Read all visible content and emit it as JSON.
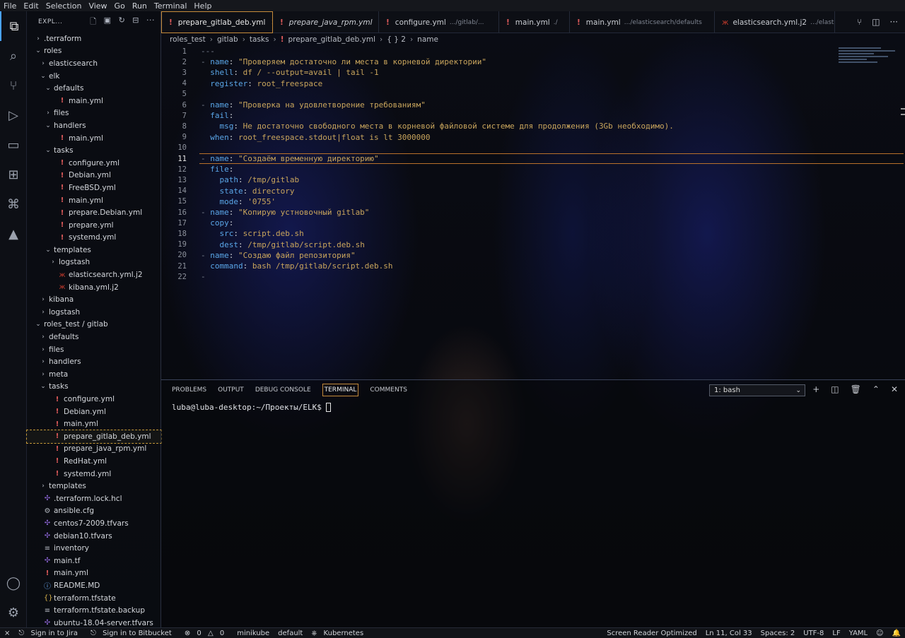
{
  "menu": [
    "File",
    "Edit",
    "Selection",
    "View",
    "Go",
    "Run",
    "Terminal",
    "Help"
  ],
  "explorer": {
    "title": "EXPL...",
    "tree": [
      {
        "label": ".terraform",
        "depth": 1,
        "type": "folder",
        "open": false
      },
      {
        "label": "roles",
        "depth": 1,
        "type": "folder",
        "open": true
      },
      {
        "label": "elasticsearch",
        "depth": 2,
        "type": "folder",
        "open": false
      },
      {
        "label": "elk",
        "depth": 2,
        "type": "folder",
        "open": true
      },
      {
        "label": "defaults",
        "depth": 3,
        "type": "folder",
        "open": true
      },
      {
        "label": "main.yml",
        "depth": 4,
        "type": "file",
        "icon": "yaml"
      },
      {
        "label": "files",
        "depth": 3,
        "type": "folder",
        "open": false
      },
      {
        "label": "handlers",
        "depth": 3,
        "type": "folder",
        "open": true
      },
      {
        "label": "main.yml",
        "depth": 4,
        "type": "file",
        "icon": "yaml"
      },
      {
        "label": "tasks",
        "depth": 3,
        "type": "folder",
        "open": true
      },
      {
        "label": "configure.yml",
        "depth": 4,
        "type": "file",
        "icon": "yaml"
      },
      {
        "label": "Debian.yml",
        "depth": 4,
        "type": "file",
        "icon": "yaml"
      },
      {
        "label": "FreeBSD.yml",
        "depth": 4,
        "type": "file",
        "icon": "yaml"
      },
      {
        "label": "main.yml",
        "depth": 4,
        "type": "file",
        "icon": "yaml"
      },
      {
        "label": "prepare.Debian.yml",
        "depth": 4,
        "type": "file",
        "icon": "yaml"
      },
      {
        "label": "prepare.yml",
        "depth": 4,
        "type": "file",
        "icon": "yaml"
      },
      {
        "label": "systemd.yml",
        "depth": 4,
        "type": "file",
        "icon": "yaml"
      },
      {
        "label": "templates",
        "depth": 3,
        "type": "folder",
        "open": true
      },
      {
        "label": "logstash",
        "depth": 4,
        "type": "folder",
        "open": false
      },
      {
        "label": "elasticsearch.yml.j2",
        "depth": 4,
        "type": "file",
        "icon": "j2"
      },
      {
        "label": "kibana.yml.j2",
        "depth": 4,
        "type": "file",
        "icon": "j2"
      },
      {
        "label": "kibana",
        "depth": 2,
        "type": "folder",
        "open": false
      },
      {
        "label": "logstash",
        "depth": 2,
        "type": "folder",
        "open": false
      },
      {
        "label": "roles_test / gitlab",
        "depth": 1,
        "type": "folder",
        "open": true
      },
      {
        "label": "defaults",
        "depth": 2,
        "type": "folder",
        "open": false
      },
      {
        "label": "files",
        "depth": 2,
        "type": "folder",
        "open": false
      },
      {
        "label": "handlers",
        "depth": 2,
        "type": "folder",
        "open": false
      },
      {
        "label": "meta",
        "depth": 2,
        "type": "folder",
        "open": false
      },
      {
        "label": "tasks",
        "depth": 2,
        "type": "folder",
        "open": true
      },
      {
        "label": "configure.yml",
        "depth": 3,
        "type": "file",
        "icon": "yaml"
      },
      {
        "label": "Debian.yml",
        "depth": 3,
        "type": "file",
        "icon": "yaml"
      },
      {
        "label": "main.yml",
        "depth": 3,
        "type": "file",
        "icon": "yaml"
      },
      {
        "label": "prepare_gitlab_deb.yml",
        "depth": 3,
        "type": "file",
        "icon": "yaml",
        "selected": true
      },
      {
        "label": "prepare_java_rpm.yml",
        "depth": 3,
        "type": "file",
        "icon": "yaml"
      },
      {
        "label": "RedHat.yml",
        "depth": 3,
        "type": "file",
        "icon": "yaml"
      },
      {
        "label": "systemd.yml",
        "depth": 3,
        "type": "file",
        "icon": "yaml"
      },
      {
        "label": "templates",
        "depth": 2,
        "type": "folder",
        "open": false
      },
      {
        "label": ".terraform.lock.hcl",
        "depth": 1,
        "type": "file",
        "icon": "tf"
      },
      {
        "label": "ansible.cfg",
        "depth": 1,
        "type": "file",
        "icon": "gear"
      },
      {
        "label": "centos7-2009.tfvars",
        "depth": 1,
        "type": "file",
        "icon": "tf"
      },
      {
        "label": "debian10.tfvars",
        "depth": 1,
        "type": "file",
        "icon": "tf"
      },
      {
        "label": "inventory",
        "depth": 1,
        "type": "file",
        "icon": "lines"
      },
      {
        "label": "main.tf",
        "depth": 1,
        "type": "file",
        "icon": "tf"
      },
      {
        "label": "main.yml",
        "depth": 1,
        "type": "file",
        "icon": "yaml"
      },
      {
        "label": "README.MD",
        "depth": 1,
        "type": "file",
        "icon": "info"
      },
      {
        "label": "terraform.tfstate",
        "depth": 1,
        "type": "file",
        "icon": "brace"
      },
      {
        "label": "terraform.tfstate.backup",
        "depth": 1,
        "type": "file",
        "icon": "lines"
      },
      {
        "label": "ubuntu-18.04-server.tfvars",
        "depth": 1,
        "type": "file",
        "icon": "tf"
      }
    ]
  },
  "tabs": [
    {
      "label": "prepare_gitlab_deb.yml",
      "desc": "",
      "icon": "yaml",
      "active": true,
      "italic": false
    },
    {
      "label": "prepare_java_rpm.yml",
      "desc": "",
      "icon": "yaml",
      "active": false,
      "italic": true
    },
    {
      "label": "configure.yml",
      "desc": ".../gitlab/...",
      "icon": "yaml",
      "active": false,
      "italic": false
    },
    {
      "label": "main.yml",
      "desc": "./",
      "icon": "yaml",
      "active": false,
      "italic": false
    },
    {
      "label": "main.yml",
      "desc": ".../elasticsearch/defaults",
      "icon": "yaml",
      "active": false,
      "italic": false
    },
    {
      "label": "elasticsearch.yml.j2",
      "desc": ".../elasticsear",
      "icon": "j2",
      "active": false,
      "italic": false
    }
  ],
  "breadcrumb": [
    "roles_test",
    "gitlab",
    "tasks",
    "prepare_gitlab_deb.yml",
    "{ } 2",
    "name"
  ],
  "editor": {
    "current_line": 11,
    "lines": [
      [
        [
          "dash",
          "---"
        ]
      ],
      [
        [
          "dash",
          "- "
        ],
        [
          "k",
          "name"
        ],
        [
          "p",
          ": "
        ],
        [
          "s",
          "\"Проверяем достаточно ли места в корневой директории\""
        ]
      ],
      [
        [
          "p",
          "  "
        ],
        [
          "k",
          "shell"
        ],
        [
          "p",
          ": "
        ],
        [
          "s",
          "df / --output=avail | tail -1"
        ]
      ],
      [
        [
          "p",
          "  "
        ],
        [
          "k",
          "register"
        ],
        [
          "p",
          ": "
        ],
        [
          "s",
          "root_freespace"
        ]
      ],
      [],
      [
        [
          "dash",
          "- "
        ],
        [
          "k",
          "name"
        ],
        [
          "p",
          ": "
        ],
        [
          "s",
          "\"Проверка на удовлетворение требованиям\""
        ]
      ],
      [
        [
          "p",
          "  "
        ],
        [
          "k",
          "fail"
        ],
        [
          "p",
          ":"
        ]
      ],
      [
        [
          "p",
          "    "
        ],
        [
          "k",
          "msg"
        ],
        [
          "p",
          ": "
        ],
        [
          "s",
          "Не достаточно свободного места в корневой файловой системе для продолжения (3Gb необходимо)."
        ]
      ],
      [
        [
          "p",
          "  "
        ],
        [
          "k",
          "when"
        ],
        [
          "p",
          ": "
        ],
        [
          "s",
          "root_freespace.stdout|float is lt 3000000"
        ]
      ],
      [],
      [
        [
          "dash",
          "- "
        ],
        [
          "k",
          "name"
        ],
        [
          "p",
          ": "
        ],
        [
          "s",
          "\"Создаём временную директорию\""
        ]
      ],
      [
        [
          "p",
          "  "
        ],
        [
          "k",
          "file"
        ],
        [
          "p",
          ":"
        ]
      ],
      [
        [
          "p",
          "    "
        ],
        [
          "k",
          "path"
        ],
        [
          "p",
          ": "
        ],
        [
          "s",
          "/tmp/gitlab"
        ]
      ],
      [
        [
          "p",
          "    "
        ],
        [
          "k",
          "state"
        ],
        [
          "p",
          ": "
        ],
        [
          "s",
          "directory"
        ]
      ],
      [
        [
          "p",
          "    "
        ],
        [
          "k",
          "mode"
        ],
        [
          "p",
          ": "
        ],
        [
          "s",
          "'0755'"
        ]
      ],
      [
        [
          "dash",
          "- "
        ],
        [
          "k",
          "name"
        ],
        [
          "p",
          ": "
        ],
        [
          "s",
          "\"Копирую устновочный gitlab\""
        ]
      ],
      [
        [
          "p",
          "  "
        ],
        [
          "k",
          "copy"
        ],
        [
          "p",
          ":"
        ]
      ],
      [
        [
          "p",
          "    "
        ],
        [
          "k",
          "src"
        ],
        [
          "p",
          ": "
        ],
        [
          "s",
          "script.deb.sh"
        ]
      ],
      [
        [
          "p",
          "    "
        ],
        [
          "k",
          "dest"
        ],
        [
          "p",
          ": "
        ],
        [
          "s",
          "/tmp/gitlab/script.deb.sh"
        ]
      ],
      [
        [
          "dash",
          "- "
        ],
        [
          "k",
          "name"
        ],
        [
          "p",
          ": "
        ],
        [
          "s",
          "\"Создаю файл репозитория\""
        ]
      ],
      [
        [
          "p",
          "  "
        ],
        [
          "k",
          "command"
        ],
        [
          "p",
          ": "
        ],
        [
          "s",
          "bash /tmp/gitlab/script.deb.sh"
        ]
      ],
      [
        [
          "dash",
          "-"
        ]
      ]
    ]
  },
  "panel": {
    "tabs": [
      "PROBLEMS",
      "OUTPUT",
      "DEBUG CONSOLE",
      "TERMINAL",
      "COMMENTS"
    ],
    "active_tab": "TERMINAL",
    "terminal_select": "1: bash",
    "prompt": "luba@luba-desktop:~/Проекты/ELK$"
  },
  "status": {
    "left": [
      "Sign in to Jira",
      "Sign in to Bitbucket",
      "0",
      "0",
      "minikube",
      "default",
      "Kubernetes"
    ],
    "right": [
      "Screen Reader Optimized",
      "Ln 11, Col 33",
      "Spaces: 2",
      "UTF-8",
      "LF",
      "YAML"
    ]
  },
  "colors": {
    "accent": "#c58a3a",
    "key": "#5aa6e8",
    "string": "#c9a55c",
    "yaml_icon": "#e05b5b"
  }
}
